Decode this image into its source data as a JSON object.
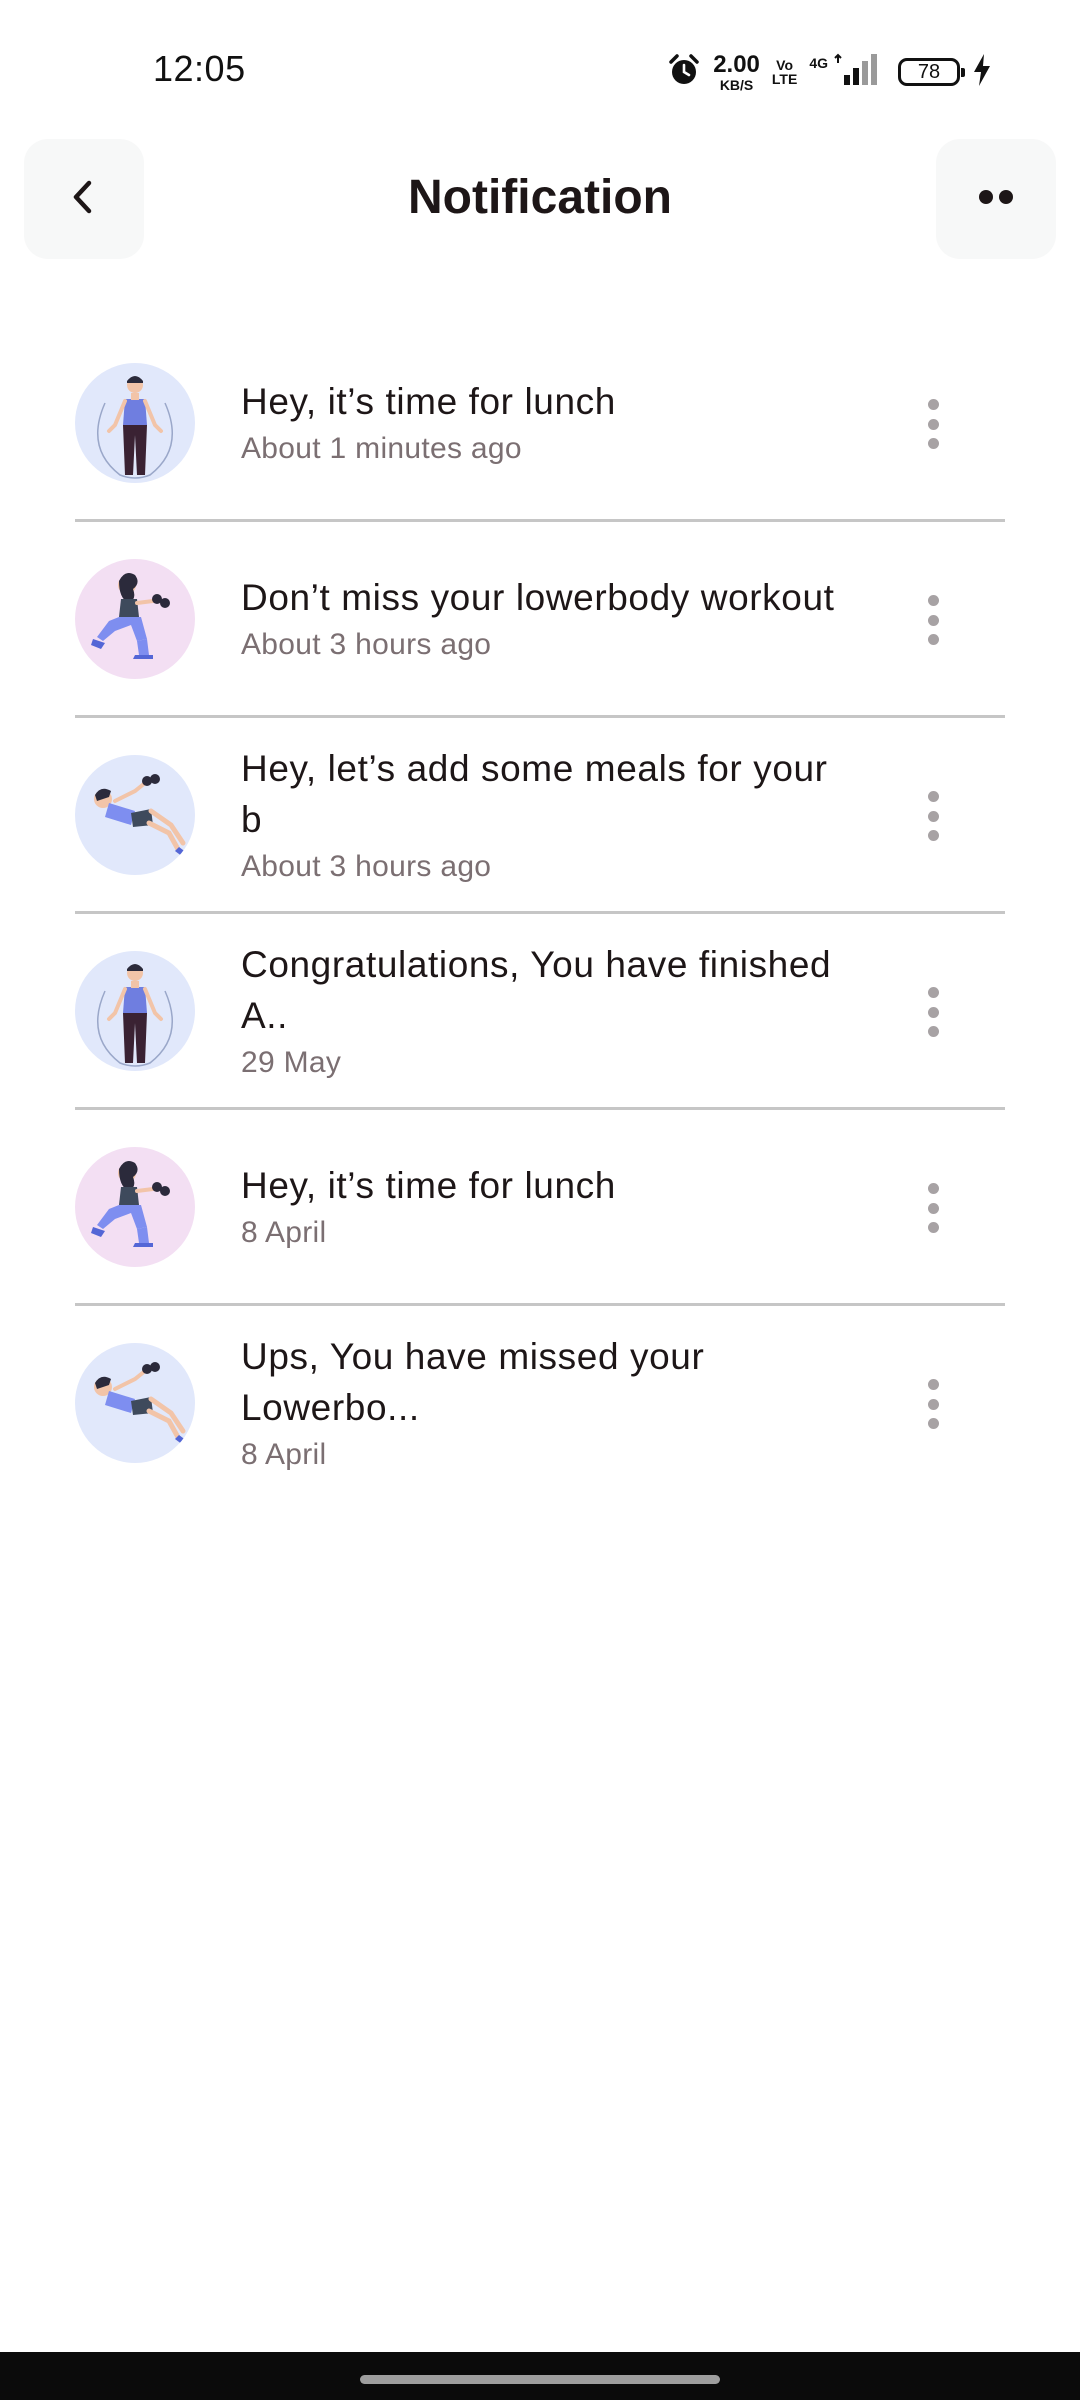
{
  "status_bar": {
    "time": "12:05",
    "net_speed_value": "2.00",
    "net_speed_unit": "KB/S",
    "volte_top": "Vo",
    "volte_bottom": "LTE",
    "network_type": "4G",
    "battery_level": "78",
    "icons": [
      "alarm-icon",
      "signal-icon",
      "battery-icon",
      "charging-icon"
    ]
  },
  "header": {
    "title": "Notification",
    "back_icon": "chevron-left-icon",
    "more_icon": "more-dots-icon"
  },
  "notifications": [
    {
      "title": "Hey, it’s time for lunch",
      "time": "About 1 minutes ago",
      "avatar": "jump-rope-man"
    },
    {
      "title": "Don’t miss your lowerbody workout",
      "time": "About 3 hours ago",
      "avatar": "dumbbell-woman"
    },
    {
      "title": "Hey, let’s add some meals for your b",
      "time": "About 3 hours ago",
      "avatar": "situp-woman"
    },
    {
      "title": "Congratulations, You have finished A..",
      "time": "29 May",
      "avatar": "jump-rope-man"
    },
    {
      "title": "Hey, it’s time for lunch",
      "time": "8 April",
      "avatar": "dumbbell-woman"
    },
    {
      "title": "Ups, You have missed your Lowerbo...",
      "time": "8 April",
      "avatar": "situp-woman"
    }
  ],
  "colors": {
    "title_text": "#1D1617",
    "secondary_text": "#7B6F72",
    "divider": "#C6C6C6",
    "header_button_bg": "#F7F8F8",
    "avatar_blue_bg": "#E1E8FB",
    "avatar_pink_bg": "#F3DFF3",
    "accent_blue": "#92A3FD"
  }
}
